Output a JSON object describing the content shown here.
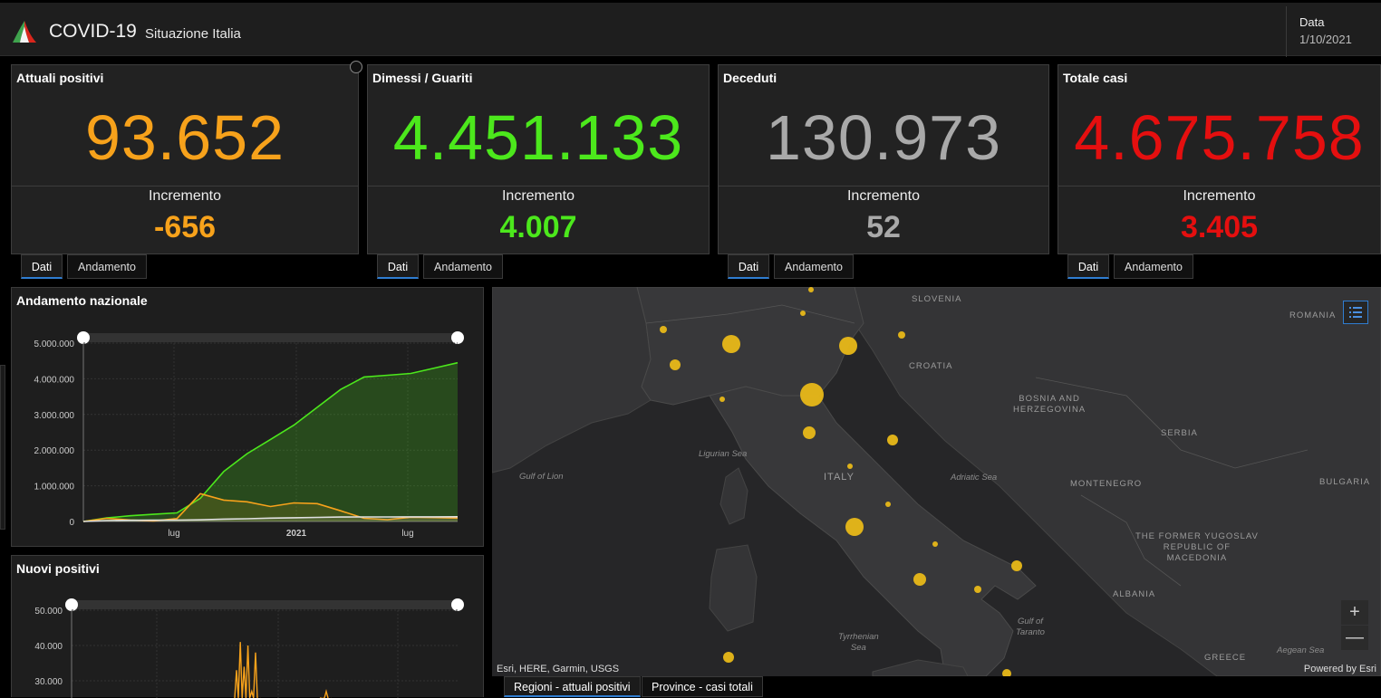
{
  "header": {
    "title": "COVID-19",
    "subtitle": "Situazione Italia",
    "date_label": "Data",
    "date_value": "1/10/2021"
  },
  "cards": [
    {
      "title": "Attuali positivi",
      "value": "93.652",
      "increment_label": "Incremento",
      "increment": "-656",
      "color": "#f7a21b"
    },
    {
      "title": "Dimessi / Guariti",
      "value": "4.451.133",
      "increment_label": "Incremento",
      "increment": "4.007",
      "color": "#4ce81c"
    },
    {
      "title": "Deceduti",
      "value": "130.973",
      "increment_label": "Incremento",
      "increment": "52",
      "color": "#a9a9a9"
    },
    {
      "title": "Totale casi",
      "value": "4.675.758",
      "increment_label": "Incremento",
      "increment": "3.405",
      "color": "#e50f0f"
    }
  ],
  "card_tabs": {
    "dati": "Dati",
    "andamento": "Andamento"
  },
  "chart_data": [
    {
      "type": "area",
      "title": "Andamento nazionale",
      "y_ticks": [
        "5.000.000",
        "4.000.000",
        "3.000.000",
        "2.000.000",
        "1.000.000",
        "0"
      ],
      "x_ticks": [
        "lug",
        "2021",
        "lug"
      ],
      "ylim": [
        0,
        5000000
      ],
      "x": [
        "2020-02",
        "2020-04",
        "2020-06",
        "2020-08",
        "2020-10",
        "2020-11",
        "2020-12",
        "2021-01",
        "2021-02",
        "2021-03",
        "2021-04",
        "2021-05",
        "2021-06",
        "2021-07",
        "2021-08",
        "2021-09",
        "2021-10"
      ],
      "series": [
        {
          "color": "#4ce81c",
          "values": [
            0,
            100000,
            160000,
            200000,
            240000,
            650000,
            1400000,
            1900000,
            2300000,
            2700000,
            3200000,
            3700000,
            4050000,
            4100000,
            4150000,
            4300000,
            4450000
          ]
        },
        {
          "color": "#f7a21b",
          "values": [
            0,
            90000,
            40000,
            15000,
            80000,
            780000,
            600000,
            550000,
            420000,
            520000,
            500000,
            300000,
            90000,
            50000,
            120000,
            110000,
            95000
          ]
        },
        {
          "color": "#e0e0e0",
          "values": [
            0,
            25000,
            34000,
            35000,
            38000,
            45000,
            65000,
            75000,
            95000,
            105000,
            115000,
            125000,
            127000,
            128000,
            129000,
            130000,
            131000
          ]
        }
      ]
    },
    {
      "type": "line",
      "title": "Nuovi positivi",
      "y_ticks": [
        "50.000",
        "40.000",
        "30.000"
      ],
      "ylim": [
        0,
        50000
      ],
      "series": [
        {
          "color": "#f7a21b",
          "values": [
            33000,
            41000,
            34000,
            40000,
            27000,
            38000,
            24000
          ]
        },
        {
          "color": "#f7a21b",
          "values": [
            25000,
            27000,
            24000
          ]
        }
      ]
    }
  ],
  "map": {
    "labels": [
      {
        "text": "SLOVENIA"
      },
      {
        "text": "ROMANIA"
      },
      {
        "text": "CROATIA"
      },
      {
        "text": "BOSNIA AND\nHERZEGOVINA"
      },
      {
        "text": "SERBIA"
      },
      {
        "text": "MONTENEGRO"
      },
      {
        "text": "BULGARIA"
      },
      {
        "text": "ITALY"
      },
      {
        "text": "THE FORMER YUGOSLAV\nREPUBLIC OF\nMACEDONIA"
      },
      {
        "text": "ALBANIA"
      },
      {
        "text": "GREECE"
      }
    ],
    "seas": [
      {
        "text": "Ligurian Sea"
      },
      {
        "text": "Gulf of Lion"
      },
      {
        "text": "Adriatic Sea"
      },
      {
        "text": "Tyrrhenian\nSea"
      },
      {
        "text": "Gulf of\nTaranto"
      },
      {
        "text": "Aegean Sea"
      }
    ],
    "attribution": "Esri, HERE, Garmin, USGS",
    "powered": "Powered by Esri",
    "zoom_in": "+",
    "zoom_out": "—",
    "bubble_color": "#e8b818",
    "tabs": [
      "Regioni - attuali positivi",
      "Province - casi totali"
    ]
  },
  "icons": {
    "logo": "italy-flag-logo",
    "legend": "list-icon",
    "expand": "expand-icon"
  }
}
